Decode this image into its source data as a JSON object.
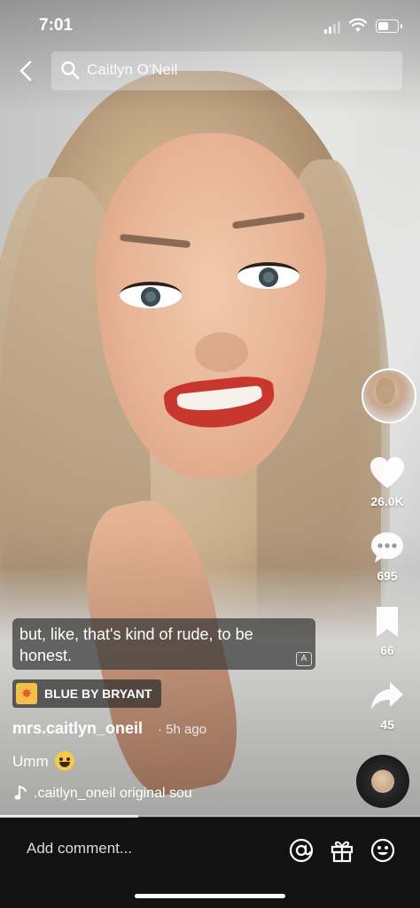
{
  "status_bar": {
    "time": "7:01"
  },
  "search": {
    "query": "Caitlyn O'Neil"
  },
  "actions": {
    "likes": "26.0K",
    "comments": "695",
    "saves": "66",
    "shares": "45"
  },
  "caption": {
    "text": "but, like, that's kind of rude, to be honest.",
    "translate_badge": "A"
  },
  "effect": {
    "label": "BLUE BY BRYANT"
  },
  "post": {
    "username": "mrs.caitlyn_oneil",
    "age": "· 5h ago",
    "description": "Umm",
    "sound": ".caitlyn_oneil    original sou"
  },
  "progress": {
    "fraction": 0.33
  },
  "comment_bar": {
    "placeholder": "Add comment..."
  },
  "icons": {
    "back": "chevron-left-icon",
    "search": "search-icon",
    "like": "heart-icon",
    "comment": "speech-bubble-icon",
    "save": "bookmark-icon",
    "share": "share-arrow-icon",
    "mention": "at-sign-icon",
    "gift": "gift-icon",
    "emoji": "smiley-icon"
  }
}
